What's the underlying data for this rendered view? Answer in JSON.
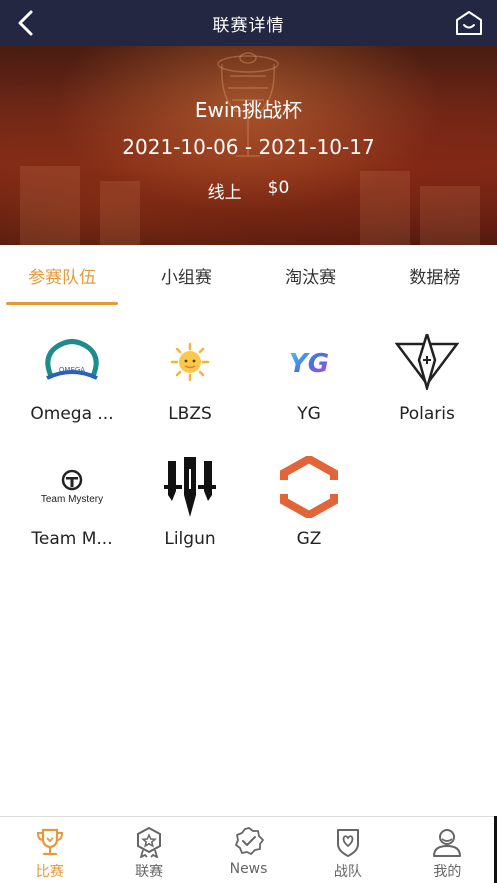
{
  "header": {
    "title": "联赛详情"
  },
  "banner": {
    "event_name": "Ewin挑战杯",
    "date_range": "2021-10-06 - 2021-10-17",
    "mode": "线上",
    "prize": "$0"
  },
  "tabs": [
    {
      "label": "参赛队伍",
      "active": true
    },
    {
      "label": "小组赛",
      "active": false
    },
    {
      "label": "淘汰赛",
      "active": false
    },
    {
      "label": "数据榜",
      "active": false
    }
  ],
  "teams": [
    {
      "name": "Omega ...",
      "logo": "omega-logo"
    },
    {
      "name": "LBZS",
      "logo": "sun-logo"
    },
    {
      "name": "YG",
      "logo": "yg-logo"
    },
    {
      "name": "Polaris",
      "logo": "polaris-logo"
    },
    {
      "name": "Team M...",
      "logo": "team-mystery-logo",
      "logo_text": "Team Mystery"
    },
    {
      "name": "Lilgun",
      "logo": "lilgun-logo"
    },
    {
      "name": "GZ",
      "logo": "gz-logo"
    }
  ],
  "bottom_nav": [
    {
      "label": "比赛",
      "icon": "trophy-icon",
      "active": true
    },
    {
      "label": "联赛",
      "icon": "medal-icon",
      "active": false
    },
    {
      "label": "News",
      "icon": "news-badge-icon",
      "active": false
    },
    {
      "label": "战队",
      "icon": "shield-icon",
      "active": false
    },
    {
      "label": "我的",
      "icon": "user-icon",
      "active": false
    }
  ],
  "colors": {
    "header_bg": "#232741",
    "accent": "#e39a3c",
    "omega_teal": "#1f8b8e",
    "omega_blue": "#2a63b5",
    "gz_orange": "#e2653a",
    "yg_blue": "#4a6fe0"
  }
}
